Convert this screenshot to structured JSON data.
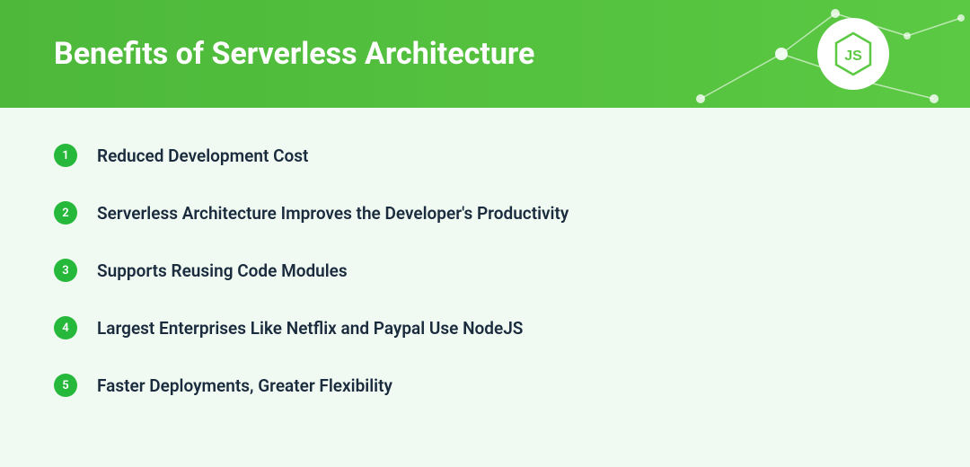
{
  "header": {
    "title": "Benefits of Serverless Architecture"
  },
  "benefits": [
    {
      "number": "1",
      "text": "Reduced Development Cost"
    },
    {
      "number": "2",
      "text": "Serverless Architecture Improves the Developer's Productivity"
    },
    {
      "number": "3",
      "text": "Supports Reusing Code Modules"
    },
    {
      "number": "4",
      "text": "Largest Enterprises Like Netflix and Paypal Use NodeJS"
    },
    {
      "number": "5",
      "text": "Faster Deployments, Greater Flexibility"
    }
  ],
  "colors": {
    "headerGreen": "#4db83a",
    "badgeGreen": "#26b83a",
    "bgTint": "#f0faf2",
    "textDark": "#1a2b3d"
  }
}
